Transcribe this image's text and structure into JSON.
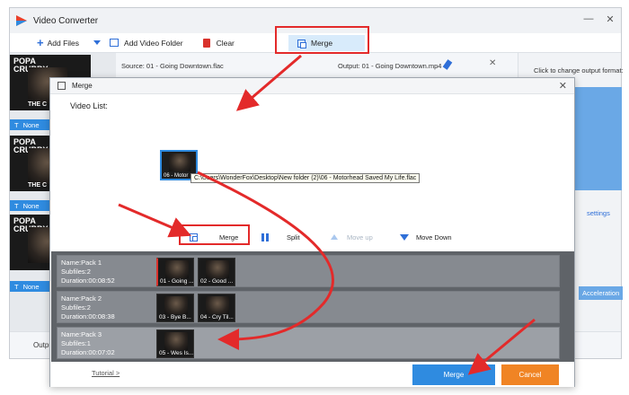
{
  "app": {
    "title": "Video Converter"
  },
  "window_controls": {
    "minimize": "—",
    "close": "✕"
  },
  "toolbar": {
    "add_files": "Add Files",
    "add_video_folder": "Add Video Folder",
    "clear": "Clear",
    "merge": "Merge"
  },
  "file_list": {
    "source": "Source: 01 - Going Downtown.flac",
    "output": "Output: 01 - Going Downtown.mp4",
    "none_label": "None",
    "thumb_title": "POPA CRUBBY",
    "thumb_sub": "THE C"
  },
  "right_panel": {
    "format_label": "Click to change output format:",
    "settings": "settings",
    "acceleration": "Acceleration"
  },
  "bottom": {
    "output_label": "Output"
  },
  "dialog": {
    "title": "Merge",
    "video_list_label": "Video List:",
    "drag_thumb_caption": "06 - Motor",
    "drag_tooltip": "C:\\Users\\WonderFox\\Desktop\\New folder (2)\\06 - Motorhead Saved My Life.flac",
    "actions": {
      "merge": "Merge",
      "split": "Split",
      "move_up": "Move up",
      "move_down": "Move Down"
    },
    "packs": [
      {
        "name": "Name:Pack 1",
        "subfiles": "Subfiles:2",
        "duration": "Duration:00:08:52",
        "clips": [
          "01 - Going ...",
          "02 - Good ..."
        ]
      },
      {
        "name": "Name:Pack 2",
        "subfiles": "Subfiles:2",
        "duration": "Duration:00:08:38",
        "clips": [
          "03 - Bye B...",
          "04 - Cry Til..."
        ]
      },
      {
        "name": "Name:Pack 3",
        "subfiles": "Subfiles:1",
        "duration": "Duration:00:07:02",
        "clips": [
          "05 - Wes Is..."
        ]
      }
    ],
    "tutorial": "Tutorial >",
    "merge_button": "Merge",
    "cancel_button": "Cancel"
  },
  "colors": {
    "accent": "#2f8be0",
    "cancel": "#f08424",
    "annotation": "#e32a2a"
  }
}
